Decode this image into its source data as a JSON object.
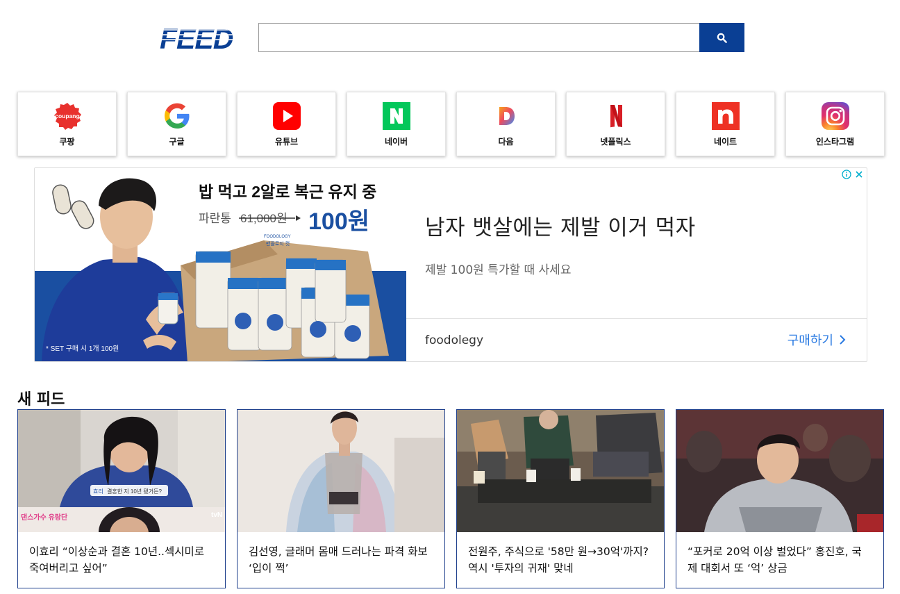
{
  "header": {
    "logo_text": "FEED",
    "search": {
      "value": "",
      "placeholder": ""
    }
  },
  "quick_links": [
    {
      "label": "쿠팡",
      "icon": "coupang-icon",
      "icon_text": "coupang",
      "color": "#e8312d"
    },
    {
      "label": "구글",
      "icon": "google-icon",
      "icon_text": "G",
      "color": "#4285f4"
    },
    {
      "label": "유튜브",
      "icon": "youtube-icon",
      "icon_text": "",
      "color": "#ff0000"
    },
    {
      "label": "네이버",
      "icon": "naver-icon",
      "icon_text": "N",
      "color": "#03c75a"
    },
    {
      "label": "다음",
      "icon": "daum-icon",
      "icon_text": "D",
      "color": "#f7a21b"
    },
    {
      "label": "넷플릭스",
      "icon": "netflix-icon",
      "icon_text": "N",
      "color": "#d81f26"
    },
    {
      "label": "네이트",
      "icon": "nate-icon",
      "icon_text": "n",
      "color": "#ee3124"
    },
    {
      "label": "인스타그램",
      "icon": "instagram-icon",
      "icon_text": "",
      "color": "#c13584"
    }
  ],
  "ad": {
    "image": {
      "headline": "밥 먹고 2알로 복근 유지 중",
      "strike_label": "파란통",
      "old_price": "61,000원",
      "new_price": "100원",
      "footnote": "* SET 구매 시 1개 100원",
      "box_brand": "FOODOLOGY",
      "product_label": "맨올로지 컷"
    },
    "headline": "남자 뱃살에는 제발 이거 먹자",
    "description": "제발 100원 특가할 때 사세요",
    "advertiser": "foodolegy",
    "cta": "구매하기"
  },
  "feed": {
    "title": "새 피드",
    "items": [
      {
        "caption": "이효리 “이상순과 결혼 10년..섹시미로 죽여버리고 싶어”",
        "subtitle": "결혼한 지 10년 됐거든?",
        "name_tag": "효리",
        "show_logo": "댄스가수 유랑단",
        "channel": "tvN"
      },
      {
        "caption": "김선영, 글래머 몸매 드러나는 파격 화보 ‘입이 쩍’"
      },
      {
        "caption": "전원주, 주식으로 '58만 원→30억'까지? 역시 '투자의 귀재' 맞네"
      },
      {
        "caption": "“포커로 20억 이상 벌었다” 홍진호, 국제 대회서 또 ‘억’ 상금"
      }
    ]
  },
  "colors": {
    "brand": "#0a3f94",
    "card_border": "#1e3f8c",
    "cta": "#2a7ae2"
  }
}
